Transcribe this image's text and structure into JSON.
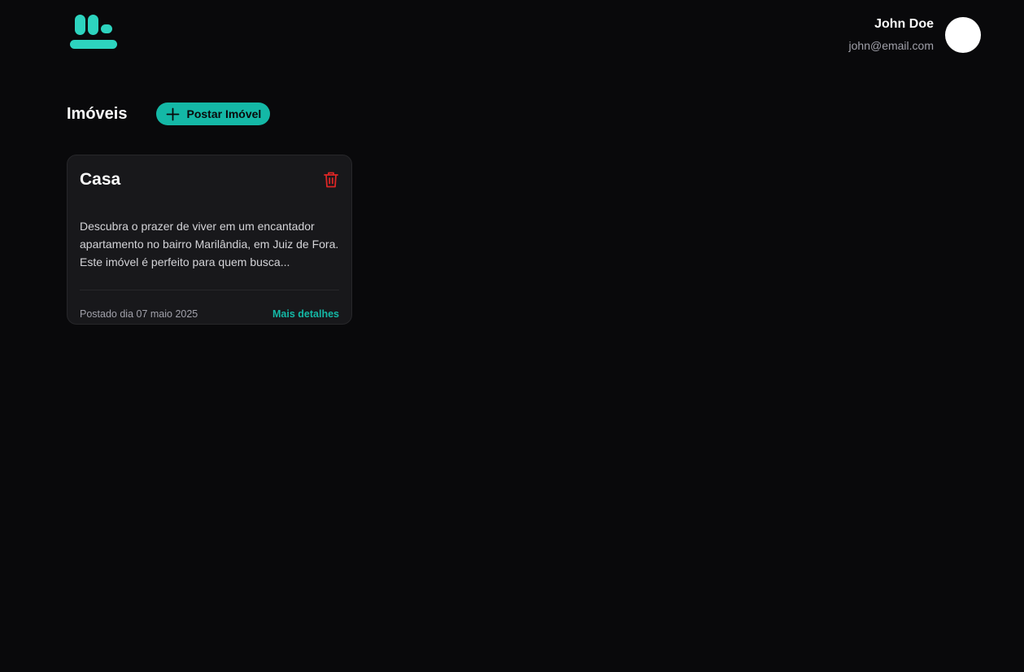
{
  "header": {
    "logo_icon": "logo-icon",
    "user": {
      "name": "John Doe",
      "email": "john@email.com",
      "avatar": "avatar"
    }
  },
  "main": {
    "title": "Imóveis",
    "post_button": {
      "label": "Postar Imóvel",
      "icon": "plus-icon"
    },
    "properties": [
      {
        "title": "Casa",
        "description": "Descubra o prazer de viver em um encantador apartamento no bairro Marilândia, em Juiz de Fora. Este imóvel é perfeito para quem busca...",
        "posted": "Postado dia 07 maio 2025",
        "details_label": "Mais detalhes",
        "delete_icon": "trash-icon"
      }
    ]
  },
  "colors": {
    "background": "#09090b",
    "card": "#18181b",
    "accent": "#14b8a6",
    "danger": "#dc2626"
  }
}
